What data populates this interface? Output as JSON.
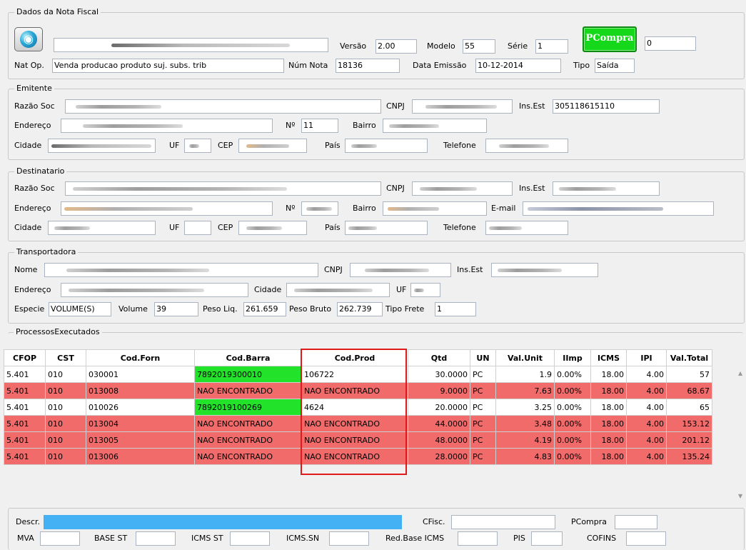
{
  "nota": {
    "title": "Dados da Nota Fiscal",
    "versao_label": "Versão",
    "versao": "2.00",
    "modelo_label": "Modelo",
    "modelo": "55",
    "serie_label": "Série",
    "serie": "1",
    "pcompra_button": "PCompra",
    "pcompra_value": "0",
    "natop_label": "Nat Op.",
    "natop": "Venda producao produto suj. subs. trib",
    "numnota_label": "Núm Nota",
    "numnota": "18136",
    "data_label": "Data Emissão",
    "data": "10-12-2014",
    "tipo_label": "Tipo",
    "tipo": "Saída",
    "logo_icon": "globe-app-icon"
  },
  "emitente": {
    "title": "Emitente",
    "razao_label": "Razão Soc",
    "cnpj_label": "CNPJ",
    "insest_label": "Ins.Est",
    "insest": "305118615110",
    "endereco_label": "Endereço",
    "numero_label": "Nº",
    "numero": "11",
    "bairro_label": "Bairro",
    "cidade_label": "Cidade",
    "uf_label": "UF",
    "cep_label": "CEP",
    "pais_label": "País",
    "telefone_label": "Telefone"
  },
  "destinatario": {
    "title": "Destinatario",
    "razao_label": "Razão Soc",
    "cnpj_label": "CNPJ",
    "insest_label": "Ins.Est",
    "endereco_label": "Endereço",
    "numero_label": "Nº",
    "bairro_label": "Bairro",
    "email_label": "E-mail",
    "cidade_label": "Cidade",
    "uf_label": "UF",
    "cep_label": "CEP",
    "pais_label": "País",
    "telefone_label": "Telefone"
  },
  "transportadora": {
    "title": "Transportadora",
    "nome_label": "Nome",
    "cnpj_label": "CNPJ",
    "insest_label": "Ins.Est",
    "endereco_label": "Endereço",
    "cidade_label": "Cidade",
    "uf_label": "UF",
    "especie_label": "Especie",
    "especie": "VOLUME(S)",
    "volume_label": "Volume",
    "volume": "39",
    "pesoliq_label": "Peso Liq.",
    "pesoliq": "261.659",
    "pesobruto_label": "Peso Bruto",
    "pesobruto": "262.739",
    "tipofrete_label": "Tipo Frete",
    "tipofrete": "1"
  },
  "processos": {
    "title": "ProcessosExecutados"
  },
  "grid": {
    "columns": [
      "CFOP",
      "CST",
      "Cod.Forn",
      "Cod.Barra",
      "Cod.Prod",
      "Qtd",
      "UN",
      "Val.Unit",
      "IImp",
      "ICMS",
      "IPI",
      "Val.Total"
    ],
    "rows": [
      {
        "status": "ok",
        "cells": [
          "5.401",
          "010",
          "030001",
          "7892019300010",
          "106722",
          "30.0000",
          "PC",
          "1.9",
          "0.00%",
          "18.00",
          "4.00",
          "57"
        ]
      },
      {
        "status": "bad",
        "cells": [
          "5.401",
          "010",
          "013008",
          "NAO ENCONTRADO",
          "NAO ENCONTRADO",
          "9.0000",
          "PC",
          "7.63",
          "0.00%",
          "18.00",
          "4.00",
          "68.67"
        ]
      },
      {
        "status": "ok",
        "cells": [
          "5.401",
          "010",
          "010026",
          "7892019100269",
          "4624",
          "20.0000",
          "PC",
          "3.25",
          "0.00%",
          "18.00",
          "4.00",
          "65"
        ]
      },
      {
        "status": "bad",
        "cells": [
          "5.401",
          "010",
          "013004",
          "NAO ENCONTRADO",
          "NAO ENCONTRADO",
          "44.0000",
          "PC",
          "3.48",
          "0.00%",
          "18.00",
          "4.00",
          "153.12"
        ]
      },
      {
        "status": "bad",
        "cells": [
          "5.401",
          "010",
          "013005",
          "NAO ENCONTRADO",
          "NAO ENCONTRADO",
          "48.0000",
          "PC",
          "4.19",
          "0.00%",
          "18.00",
          "4.00",
          "201.12"
        ]
      },
      {
        "status": "bad",
        "cells": [
          "5.401",
          "010",
          "013006",
          "NAO ENCONTRADO",
          "NAO ENCONTRADO",
          "28.0000",
          "PC",
          "4.83",
          "0.00%",
          "18.00",
          "4.00",
          "135.24"
        ]
      }
    ],
    "colors": {
      "bad_row": "#f26b6b",
      "barcode_found": "#22e22a",
      "highlight_border": "#e01919"
    }
  },
  "detalhe": {
    "descr_label": "Descr.",
    "cfisc_label": "CFisc.",
    "pcompra_label": "PCompra",
    "mva_label": "MVA",
    "basest_label": "BASE ST",
    "icmsst_label": "ICMS ST",
    "icmssn_label": "ICMS.SN",
    "redbase_label": "Red.Base ICMS",
    "pis_label": "PIS",
    "cofins_label": "COFINS",
    "descr_color": "#45b1f5"
  }
}
